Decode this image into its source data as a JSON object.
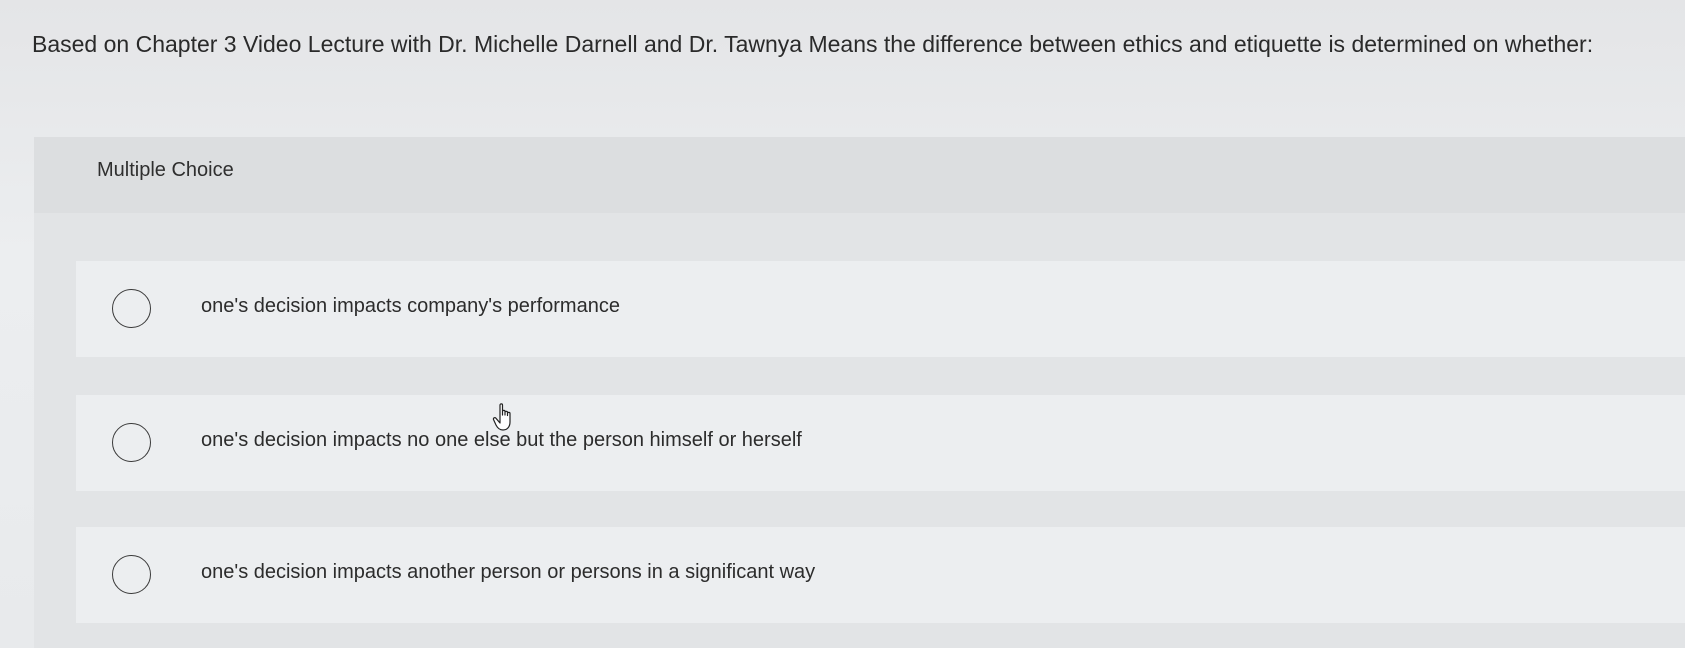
{
  "question": {
    "text": "Based on Chapter 3 Video Lecture with Dr. Michelle Darnell and Dr. Tawnya Means the difference between ethics and etiquette is determined on whether:"
  },
  "panel": {
    "type_label": "Multiple Choice",
    "options": [
      {
        "label": "one's decision impacts company's performance",
        "selected": false
      },
      {
        "label": "one's decision impacts no one else but the person himself or herself",
        "selected": false
      },
      {
        "label": "one's decision impacts another person or persons in a significant way",
        "selected": false
      }
    ]
  },
  "cursor": {
    "icon": "hand-pointer-icon"
  }
}
